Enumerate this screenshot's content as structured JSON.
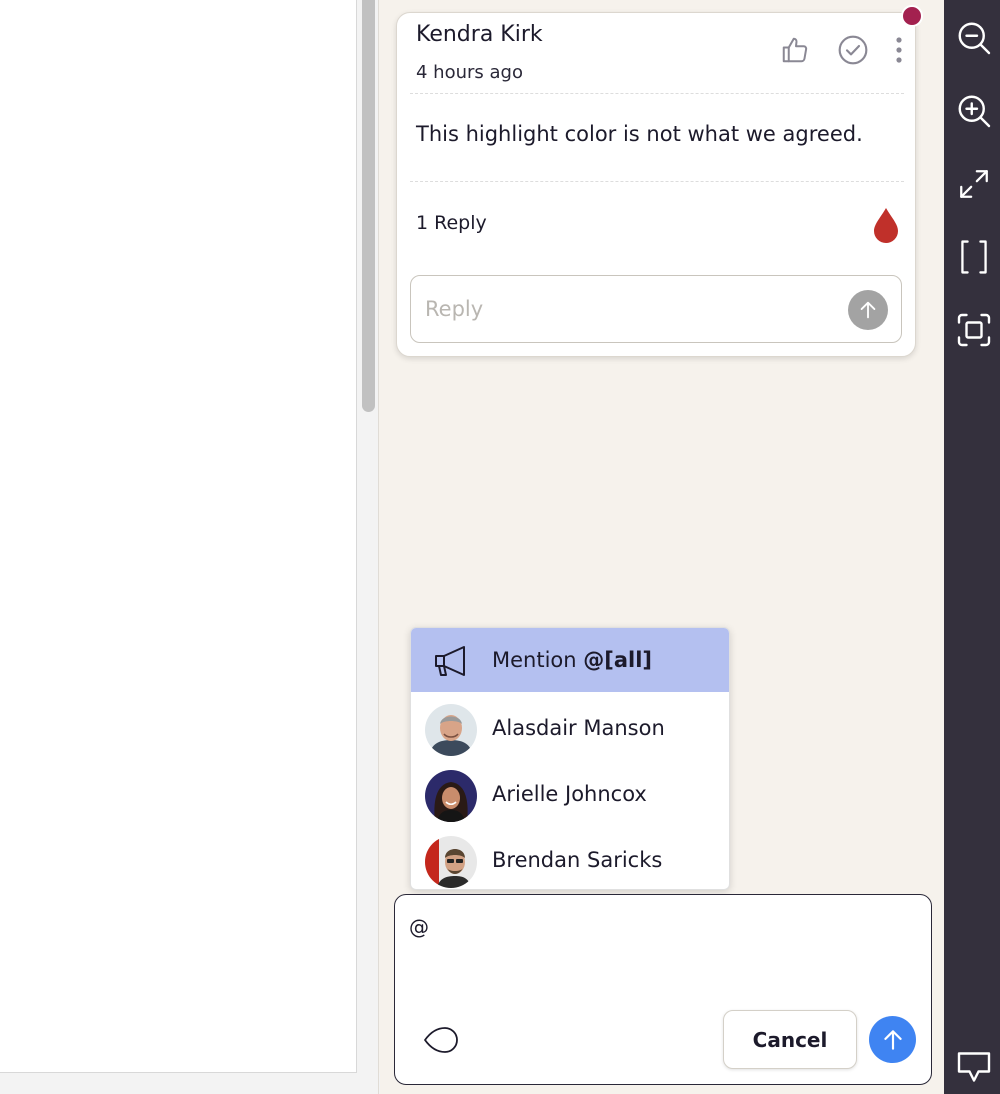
{
  "comment": {
    "author": "Kendra Kirk",
    "timestamp": "4 hours ago",
    "body": "This highlight color is not what we agreed.",
    "reply_count": "1 Reply",
    "reply_placeholder": "Reply",
    "unread_color": "#a3214f",
    "highlight_color": "#c0302a"
  },
  "mentions": {
    "all": {
      "prefix": "Mention ",
      "tag": "@[all]",
      "icon": "megaphone-icon"
    },
    "people": [
      {
        "name": "Alasdair Manson"
      },
      {
        "name": "Arielle Johncox"
      },
      {
        "name": "Brendan Saricks"
      }
    ]
  },
  "compose": {
    "text": "@",
    "cancel_label": "Cancel",
    "submit_color": "#3f84f2"
  },
  "toolbar": {
    "icons": [
      "zoom-out-icon",
      "zoom-in-icon",
      "expand-icon",
      "bracket-icon",
      "fit-frame-icon",
      "comments-icon"
    ],
    "background": "#34303d"
  }
}
